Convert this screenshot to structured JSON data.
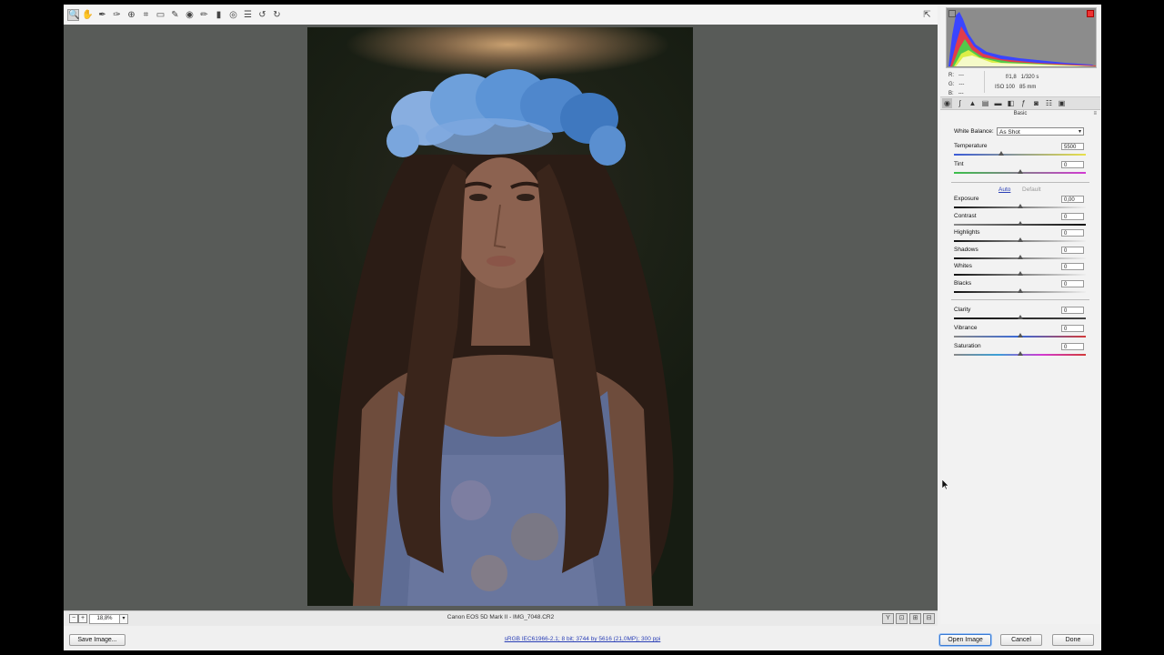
{
  "toolbar": {
    "tools": [
      {
        "name": "zoom-tool",
        "icon": "🔍"
      },
      {
        "name": "hand-tool",
        "icon": "✋"
      },
      {
        "name": "white-balance-tool",
        "icon": "✒"
      },
      {
        "name": "color-sampler-tool",
        "icon": "✑"
      },
      {
        "name": "targeted-adjustment-tool",
        "icon": "⊕"
      },
      {
        "name": "crop-tool",
        "icon": "⌗"
      },
      {
        "name": "straighten-tool",
        "icon": "▭"
      },
      {
        "name": "spot-removal-tool",
        "icon": "✎"
      },
      {
        "name": "red-eye-tool",
        "icon": "◉"
      },
      {
        "name": "adjustment-brush-tool",
        "icon": "✏"
      },
      {
        "name": "graduated-filter-tool",
        "icon": "▮"
      },
      {
        "name": "radial-filter-tool",
        "icon": "◎"
      },
      {
        "name": "preferences",
        "icon": "☰"
      },
      {
        "name": "rotate-ccw",
        "icon": "↺"
      },
      {
        "name": "rotate-cw",
        "icon": "↻"
      }
    ],
    "fullscreen_icon": "⇱"
  },
  "status": {
    "zoom": "18,8%",
    "filename": "Canon EOS 5D Mark II  -  IMG_7048.CR2",
    "view_icons": [
      "Y",
      "⊡",
      "⊞",
      "⊟"
    ]
  },
  "histogram": {
    "r": "R:",
    "g": "G:",
    "b": "B:",
    "r_val": "---",
    "g_val": "---",
    "b_val": "---",
    "aperture": "f/1,8",
    "shutter": "1/320 s",
    "iso": "ISO 100",
    "focal": "85 mm"
  },
  "panel": {
    "title": "Basic",
    "menu_icon": "≡",
    "white_balance_label": "White Balance:",
    "white_balance_value": "As Shot",
    "temperature_label": "Temperature",
    "temperature_value": "5500",
    "tint_label": "Tint",
    "tint_value": "0",
    "auto": "Auto",
    "default": "Default",
    "sliders": [
      {
        "key": "exposure",
        "label": "Exposure",
        "value": "0,00",
        "pos": 0.5
      },
      {
        "key": "contrast",
        "label": "Contrast",
        "value": "0",
        "pos": 0.5
      },
      {
        "key": "highlights",
        "label": "Highlights",
        "value": "0",
        "pos": 0.5
      },
      {
        "key": "shadows",
        "label": "Shadows",
        "value": "0",
        "pos": 0.5
      },
      {
        "key": "whites",
        "label": "Whites",
        "value": "0",
        "pos": 0.5
      },
      {
        "key": "blacks",
        "label": "Blacks",
        "value": "0",
        "pos": 0.5
      }
    ],
    "presence": [
      {
        "key": "clarity",
        "label": "Clarity",
        "value": "0",
        "pos": 0.5
      },
      {
        "key": "vibrance",
        "label": "Vibrance",
        "value": "0",
        "pos": 0.5
      },
      {
        "key": "saturation",
        "label": "Saturation",
        "value": "0",
        "pos": 0.5
      }
    ],
    "temperature_pos": 0.36,
    "tint_pos": 0.5
  },
  "bottom": {
    "save_image": "Save Image...",
    "workflow": "sRGB IEC61966-2.1; 8 bit; 3744 by 5616 (21,0MP); 300 ppi",
    "open_image": "Open Image",
    "cancel": "Cancel",
    "done": "Done"
  },
  "colors": {
    "canvas_bg": "#585b58",
    "link_blue": "#2a3fb6"
  }
}
